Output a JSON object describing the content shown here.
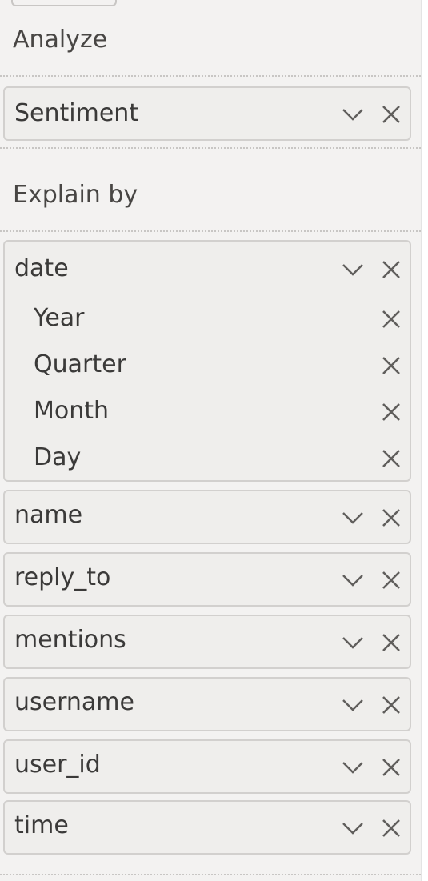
{
  "analyze": {
    "heading": "Analyze",
    "field": "Sentiment"
  },
  "explain_by": {
    "heading": "Explain by",
    "date": {
      "label": "date",
      "hierarchy": [
        "Year",
        "Quarter",
        "Month",
        "Day"
      ]
    },
    "fields": [
      "name",
      "reply_to",
      "mentions",
      "username",
      "user_id",
      "time"
    ]
  },
  "icons": {
    "expand": "chevron-down-icon",
    "remove": "close-icon"
  }
}
